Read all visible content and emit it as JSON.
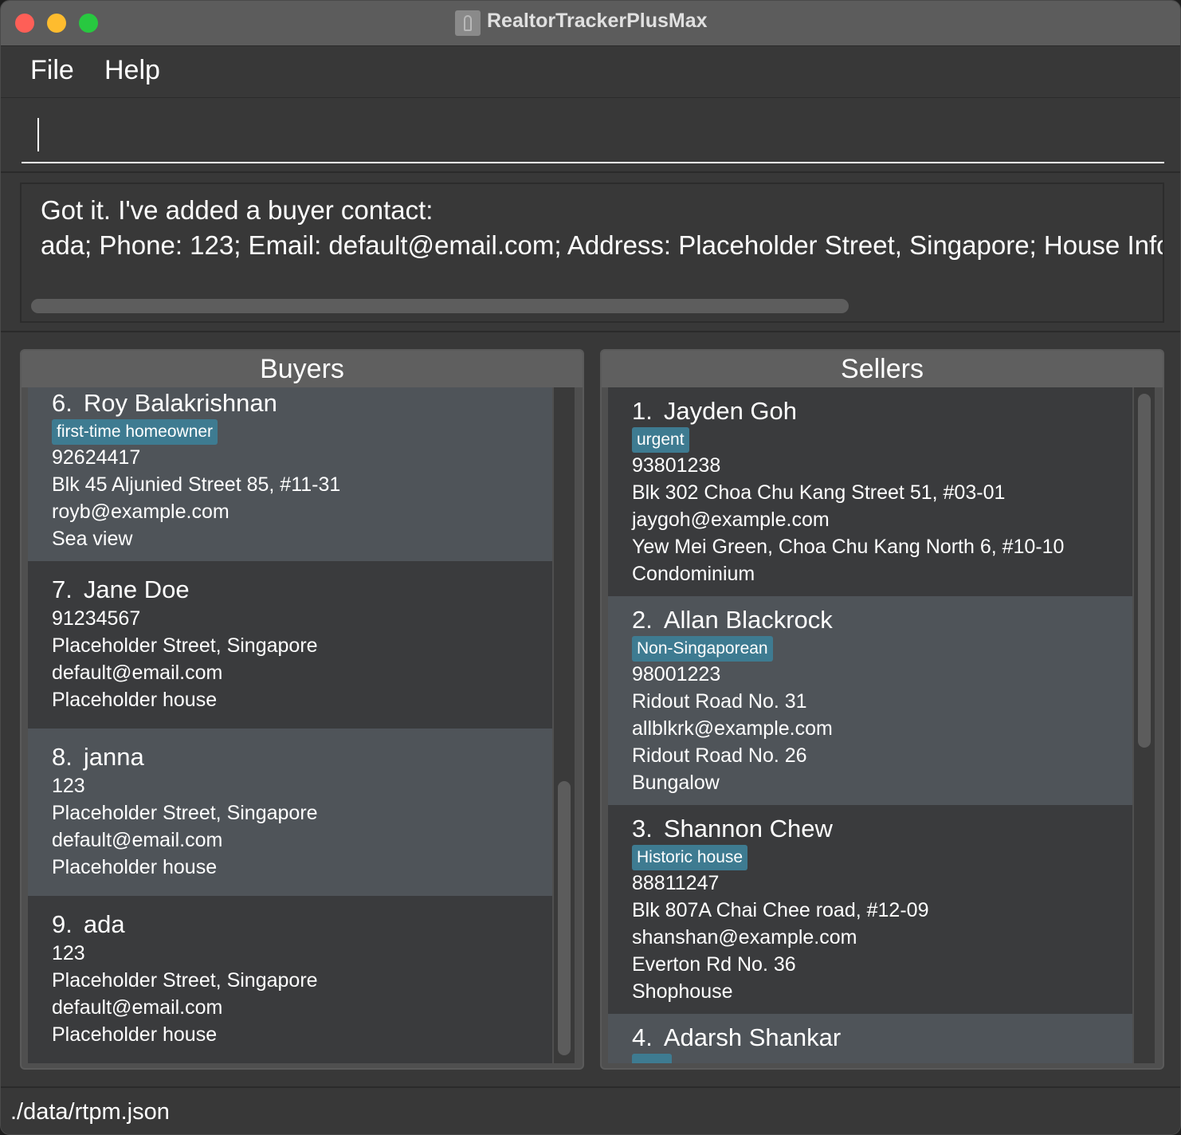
{
  "window": {
    "title": "RealtorTrackerPlusMax"
  },
  "menu": {
    "file": "File",
    "help": "Help"
  },
  "command": {
    "value": ""
  },
  "result": {
    "line1": "Got it. I've added a buyer contact:",
    "line2": "ada; Phone: 123; Email: default@email.com; Address: Placeholder Street, Singapore; House Info: Pl"
  },
  "buyers": {
    "header": "Buyers",
    "cards": [
      {
        "index": "6.",
        "name": "Roy Balakrishnan",
        "tag": "first-time homeowner",
        "phone": "92624417",
        "address": "Blk 45 Aljunied Street 85, #11-31",
        "email": "royb@example.com",
        "house": "Sea view"
      },
      {
        "index": "7.",
        "name": "Jane Doe",
        "phone": "91234567",
        "address": "Placeholder Street, Singapore",
        "email": "default@email.com",
        "house": "Placeholder house"
      },
      {
        "index": "8.",
        "name": "janna",
        "phone": "123",
        "address": "Placeholder Street, Singapore",
        "email": "default@email.com",
        "house": "Placeholder house"
      },
      {
        "index": "9.",
        "name": "ada",
        "phone": "123",
        "address": "Placeholder Street, Singapore",
        "email": "default@email.com",
        "house": "Placeholder house"
      }
    ]
  },
  "sellers": {
    "header": "Sellers",
    "cards": [
      {
        "index": "1.",
        "name": "Jayden Goh",
        "tag": "urgent",
        "phone": "93801238",
        "address": "Blk 302 Choa Chu Kang Street 51, #03-01",
        "email": "jaygoh@example.com",
        "selling_address": "Yew Mei Green, Choa Chu Kang North 6, #10-10",
        "house": "Condominium"
      },
      {
        "index": "2.",
        "name": "Allan Blackrock",
        "tag": "Non-Singaporean",
        "phone": "98001223",
        "address": "Ridout Road No. 31",
        "email": "allblkrk@example.com",
        "selling_address": "Ridout Road No. 26",
        "house": "Bungalow"
      },
      {
        "index": "3.",
        "name": "Shannon Chew",
        "tag": "Historic house",
        "phone": "88811247",
        "address": "Blk 807A Chai Chee road, #12-09",
        "email": "shanshan@example.com",
        "selling_address": "Everton Rd No. 36",
        "house": "Shophouse"
      },
      {
        "index": "4.",
        "name": "Adarsh Shankar"
      }
    ]
  },
  "status": {
    "file_path": "./data/rtpm.json"
  },
  "colors": {
    "tag": "#3e7b91",
    "card_odd": "#4f5459",
    "card_even": "#3a3b3d",
    "background": "#383838"
  }
}
